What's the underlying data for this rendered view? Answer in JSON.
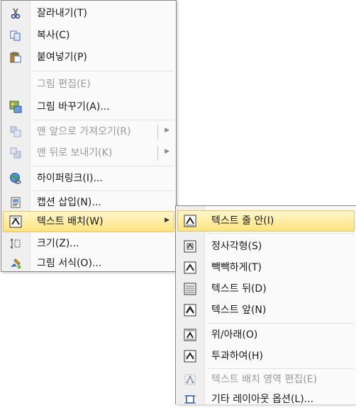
{
  "main_menu": {
    "items": [
      {
        "label": "잘라내기(T)",
        "icon": "cut-icon",
        "disabled": false
      },
      {
        "label": "복사(C)",
        "icon": "copy-icon",
        "disabled": false
      },
      {
        "label": "붙여넣기(P)",
        "icon": "paste-icon",
        "disabled": false
      },
      {
        "label": "그림 편집(E)",
        "icon": "",
        "disabled": true
      },
      {
        "label": "그림 바꾸기(A)...",
        "icon": "change-picture-icon",
        "disabled": false
      },
      {
        "label": "맨 앞으로 가져오기(R)",
        "icon": "bring-to-front-icon",
        "disabled": true
      },
      {
        "label": "맨 뒤로 보내기(K)",
        "icon": "send-to-back-icon",
        "disabled": true
      },
      {
        "label": "하이퍼링크(I)...",
        "icon": "hyperlink-icon",
        "disabled": false
      },
      {
        "label": "캡션 삽입(N)...",
        "icon": "insert-caption-icon",
        "disabled": false
      },
      {
        "label": "텍스트 배치(W)",
        "icon": "text-wrap-icon",
        "disabled": false
      },
      {
        "label": "크기(Z)...",
        "icon": "size-icon",
        "disabled": false
      },
      {
        "label": "그림 서식(O)...",
        "icon": "format-picture-icon",
        "disabled": false
      }
    ]
  },
  "sub_menu": {
    "items": [
      {
        "label": "텍스트 줄 안(I)",
        "icon": "wrap-inline-icon",
        "disabled": false
      },
      {
        "label": "정사각형(S)",
        "icon": "wrap-square-icon",
        "disabled": false
      },
      {
        "label": "빽빽하게(T)",
        "icon": "wrap-tight-icon",
        "disabled": false
      },
      {
        "label": "텍스트 뒤(D)",
        "icon": "wrap-behind-icon",
        "disabled": false
      },
      {
        "label": "텍스트 앞(N)",
        "icon": "wrap-front-icon",
        "disabled": false
      },
      {
        "label": "위/아래(O)",
        "icon": "wrap-top-bottom-icon",
        "disabled": false
      },
      {
        "label": "투과하여(H)",
        "icon": "wrap-through-icon",
        "disabled": false
      },
      {
        "label": "텍스트 배치 영역 편집(E)",
        "icon": "edit-wrap-points-icon",
        "disabled": true
      },
      {
        "label": "기타 레이아웃 옵션(L)...",
        "icon": "more-layout-options-icon",
        "disabled": false
      }
    ]
  },
  "colors": {
    "hover_top": "#fff6cc",
    "hover_bottom": "#ffe37f",
    "hover_border": "#e5c365",
    "disabled_text": "#9a9a9a"
  }
}
